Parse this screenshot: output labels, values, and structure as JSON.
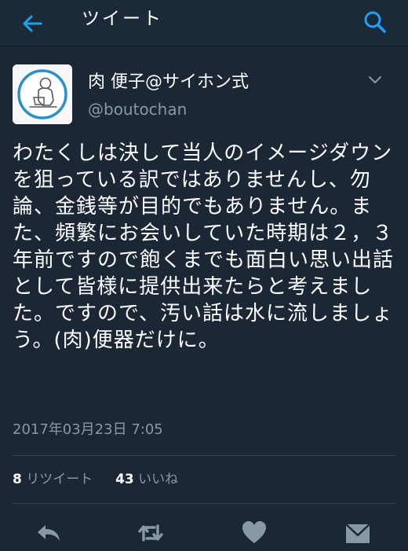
{
  "header": {
    "title": "ツイート",
    "back_icon": "back-arrow-icon",
    "search_icon": "search-icon",
    "accent_color": "#1da1f2"
  },
  "tweet": {
    "author_name": "肉 便子@サイホン式",
    "author_handle": "@boutochan",
    "text": "わたくしは決して当人のイメージダウンを狙っている訳ではありませんし、勿論、金銭等が目的でもありません。また、頻繁にお会いしていた時期は２，３年前ですので飽くまでも面白い思い出話として皆様に提供出来たらと考えました。ですので、汚い話は水に流しましょう。(肉)便器だけに。",
    "timestamp": "2017年03月23日 7:05"
  },
  "stats": {
    "retweets_count": "8",
    "retweets_label": "リツイート",
    "likes_count": "43",
    "likes_label": "いいね"
  },
  "actions": {
    "reply_icon": "reply-icon",
    "retweet_icon": "retweet-icon",
    "like_icon": "heart-icon",
    "dm_icon": "envelope-icon"
  }
}
